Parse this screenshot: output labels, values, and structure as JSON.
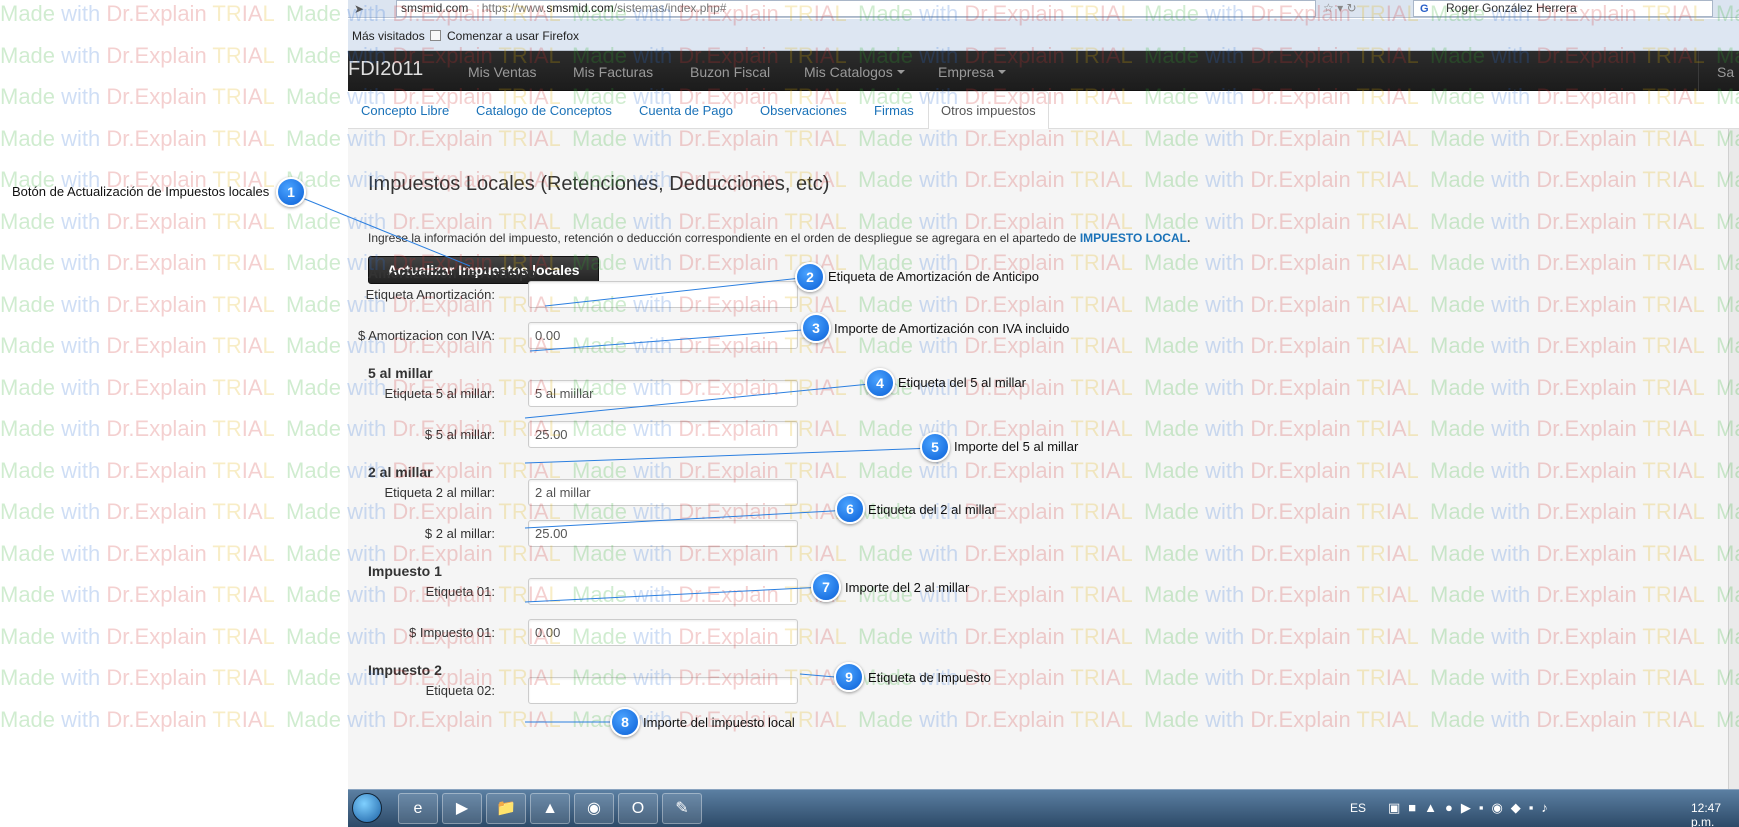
{
  "browser": {
    "url_host": "smsmid.com",
    "url_full_prefix": "https://www.",
    "url_full_domain": "smsmid.com",
    "url_full_path": "/sistemas/index.php#",
    "search_account": "Roger González Herrera"
  },
  "bookmarks": {
    "most_visited": "Más visitados",
    "get_started": "Comenzar a usar Firefox"
  },
  "app_nav": {
    "brand": "FDI2011",
    "items": [
      "Mis Ventas",
      "Mis Facturas",
      "Buzon Fiscal",
      "Mis Catalogos",
      "Empresa"
    ],
    "right": "Sa"
  },
  "tabs": [
    "Concepto Libre",
    "Catalogo de Conceptos",
    "Cuenta de Pago",
    "Observaciones",
    "Firmas",
    "Otros impuestos"
  ],
  "form": {
    "title": "Impuestos Locales (Retenciones, Deducciones, etc)",
    "intro": "Ingrese la información del impuesto, retención o deducción correspondiente en el orden de despliegue se agregara en el apartedo de",
    "intro_link": "IMPUESTO LOCAL",
    "intro_end": ".",
    "update_button": "Actualizar Impuestos locales",
    "sections": {
      "amortizacion": {
        "heading": "Amortizacion de Anticipo",
        "label_field": "Etiqueta Amortización:",
        "label_value": "",
        "amount_field": "$ Amortizacion con IVA:",
        "amount_value": "0.00"
      },
      "cinco": {
        "heading": "5 al millar",
        "label_field": "Etiqueta 5 al millar:",
        "label_value": "5 al miillar",
        "amount_field": "$ 5 al millar:",
        "amount_value": "25.00"
      },
      "dos": {
        "heading": "2 al millar",
        "label_field": "Etiqueta 2 al millar:",
        "label_value": "2 al millar",
        "amount_field": "$ 2 al millar:",
        "amount_value": "25.00"
      },
      "imp1": {
        "heading": "Impuesto 1",
        "label_field": "Etiqueta 01:",
        "label_value": "",
        "amount_field": "$ Impuesto 01:",
        "amount_value": "0.00"
      },
      "imp2": {
        "heading": "Impuesto 2",
        "label_field": "Etiqueta 02:",
        "label_value": ""
      }
    }
  },
  "taskbar": {
    "lang": "ES",
    "clock": "12:47 p.m."
  },
  "callouts": [
    {
      "n": "1",
      "text": "Botón de Actualización de Impuestos locales"
    },
    {
      "n": "2",
      "text": "Etiqueta de Amortización de Anticipo"
    },
    {
      "n": "3",
      "text": "Importe de Amortización con IVA incluido"
    },
    {
      "n": "4",
      "text": "Etiqueta del 5 al millar"
    },
    {
      "n": "5",
      "text": "Importe del 5 al millar"
    },
    {
      "n": "6",
      "text": "Etiqueta del 2 al millar"
    },
    {
      "n": "7",
      "text": "Importe del 2 al millar"
    },
    {
      "n": "8",
      "text": "Importe del impuesto local"
    },
    {
      "n": "9",
      "text": "Etiqueta de Impuesto"
    }
  ],
  "watermark": {
    "made": "Made",
    "with": "with",
    "brand": "Dr.Explain",
    "tr": "TR",
    "ia": "IA",
    "l": "L"
  },
  "colors": {
    "accent_link": "#1a72b8",
    "nav_bg": "#222222",
    "badge": "#0a5fd6",
    "callout_line": "#2b7fe0"
  }
}
